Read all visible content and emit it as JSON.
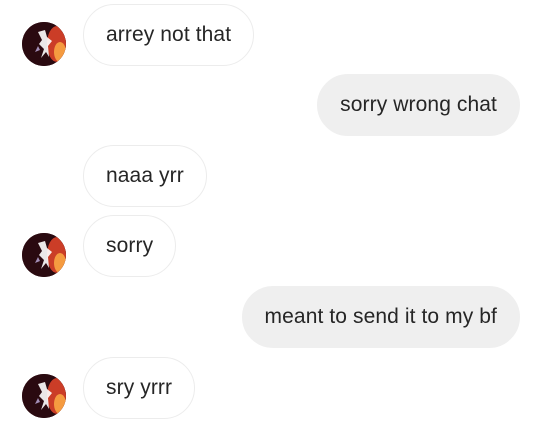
{
  "messages": [
    {
      "direction": "incoming",
      "text": "arrey not that",
      "show_avatar": true
    },
    {
      "direction": "outgoing",
      "text": "sorry wrong chat"
    },
    {
      "direction": "incoming",
      "text": "naaa yrr",
      "show_avatar": false
    },
    {
      "direction": "incoming",
      "text": "sorry",
      "show_avatar": true
    },
    {
      "direction": "outgoing",
      "text": "meant to send it to my bf"
    },
    {
      "direction": "incoming",
      "text": "sry yrrr",
      "show_avatar": true
    }
  ],
  "colors": {
    "incoming_bubble": "#ffffff",
    "incoming_border": "#ececec",
    "outgoing_bubble": "#efefef",
    "text": "#262626"
  },
  "icons": {
    "avatar": "profile-photo"
  }
}
